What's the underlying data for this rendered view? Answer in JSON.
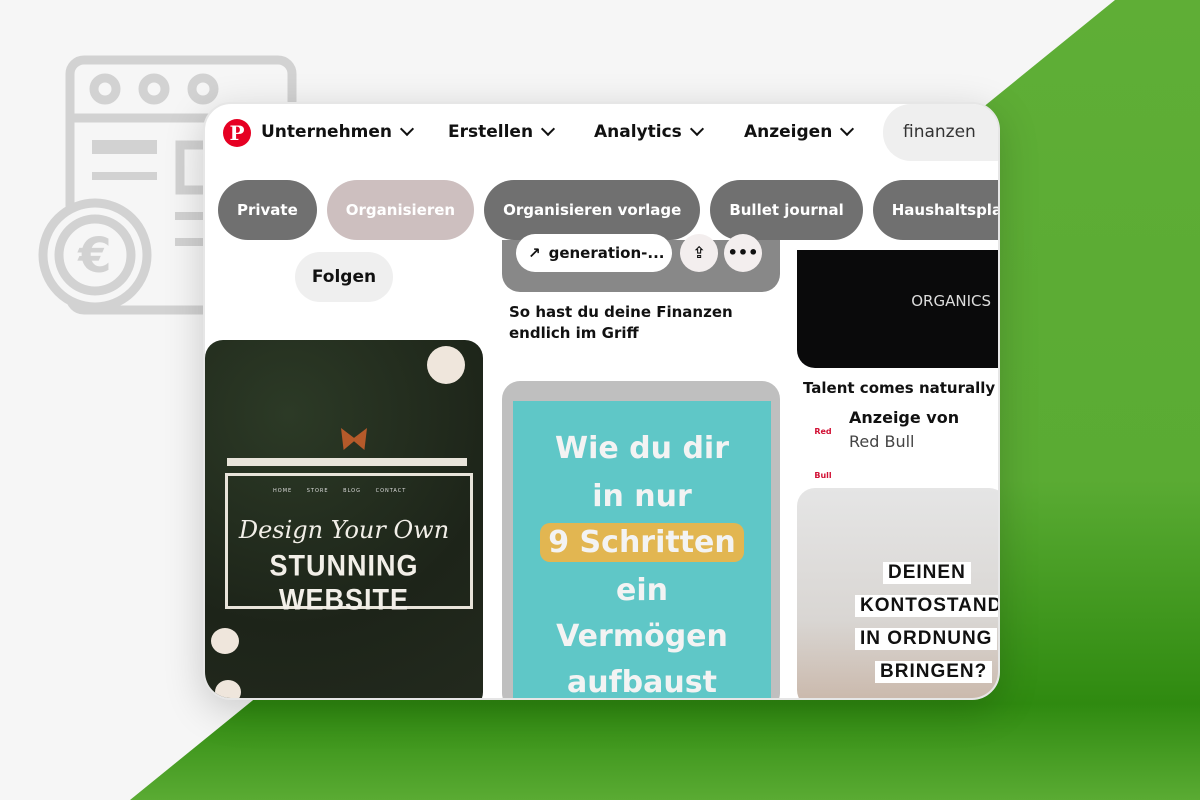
{
  "colors": {
    "brand": "#e60023",
    "green_bg": "#5aab33",
    "chip": "#707070",
    "chip_active": "#cdbfbf"
  },
  "nav": {
    "logo": "P",
    "items": [
      {
        "label": "Unternehmen"
      },
      {
        "label": "Erstellen"
      },
      {
        "label": "Analytics"
      },
      {
        "label": "Anzeigen"
      }
    ],
    "search_value": "finanzen"
  },
  "chips": [
    {
      "label": "Private"
    },
    {
      "label": "Organisieren"
    },
    {
      "label": "Organisieren vorlage"
    },
    {
      "label": "Bullet journal"
    },
    {
      "label": "Haushaltsplan"
    }
  ],
  "follow_label": "Folgen",
  "pins": {
    "website": {
      "menu": "HOME STORE BLOG CONTACT",
      "script_text": "Design Your Own",
      "block_text": "STUNNING WEBSITE"
    },
    "finance_top": {
      "source": "generation-...",
      "title": "So hast du deine Finanzen endlich im Griff"
    },
    "steps": {
      "lines": [
        "Wie du dir",
        "in nur",
        "9 Schritten",
        "ein",
        "Vermögen",
        "aufbaust"
      ]
    },
    "ad": {
      "brand_text": "ORGANICS",
      "title": "Talent comes naturally",
      "ad_label": "Anzeige von",
      "advertiser": "Red Bull",
      "logo_text": "Red Bull"
    },
    "konto": {
      "lines": [
        "DEINEN",
        "KONTOSTAND",
        "IN ORDNUNG",
        "BRINGEN?"
      ]
    }
  }
}
